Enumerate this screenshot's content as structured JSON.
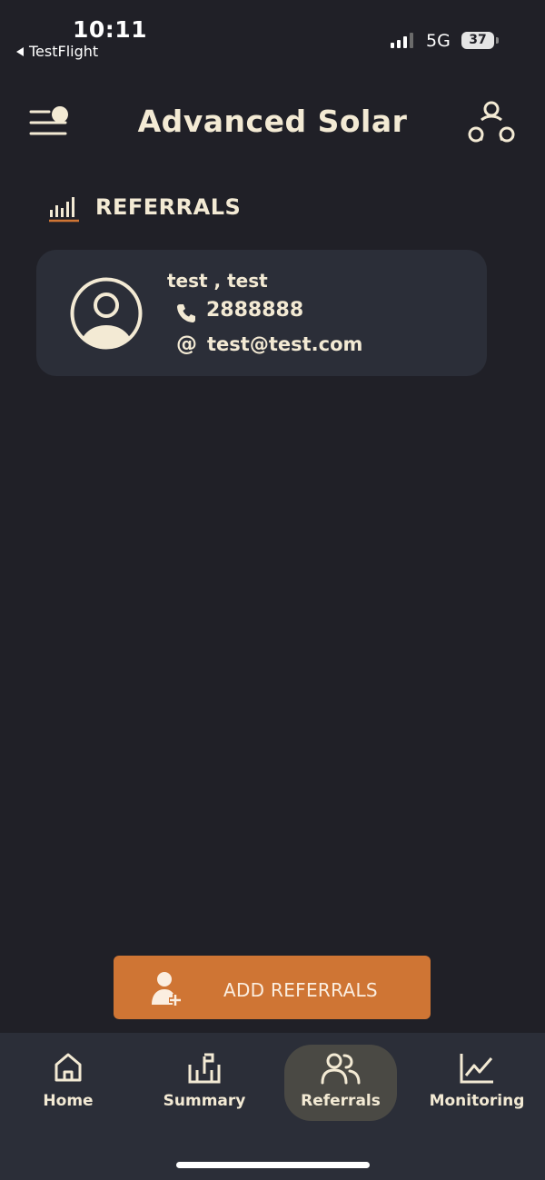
{
  "status_bar": {
    "time": "10:11",
    "back_app": "TestFlight",
    "network": "5G",
    "battery": "37"
  },
  "header": {
    "title": "Advanced Solar",
    "menu_icon": "menu-sun-icon",
    "share_icon": "share-network-icon"
  },
  "section": {
    "title": "REFERRALS",
    "icon": "bar-chart-icon"
  },
  "referrals": [
    {
      "name": "test , test",
      "phone": "2888888",
      "email_prefix": "@",
      "email": "test@test.com"
    }
  ],
  "add_button": {
    "label": "ADD REFERRALS",
    "icon": "add-user-icon"
  },
  "nav": {
    "items": [
      {
        "label": "Home",
        "icon": "home-icon"
      },
      {
        "label": "Summary",
        "icon": "summary-icon"
      },
      {
        "label": "Referrals",
        "icon": "users-icon"
      },
      {
        "label": "Monitoring",
        "icon": "line-chart-icon"
      }
    ],
    "active": "Referrals"
  },
  "colors": {
    "background": "#202027",
    "card": "#2b2e38",
    "text": "#f3ead4",
    "accent": "#cf7534"
  }
}
